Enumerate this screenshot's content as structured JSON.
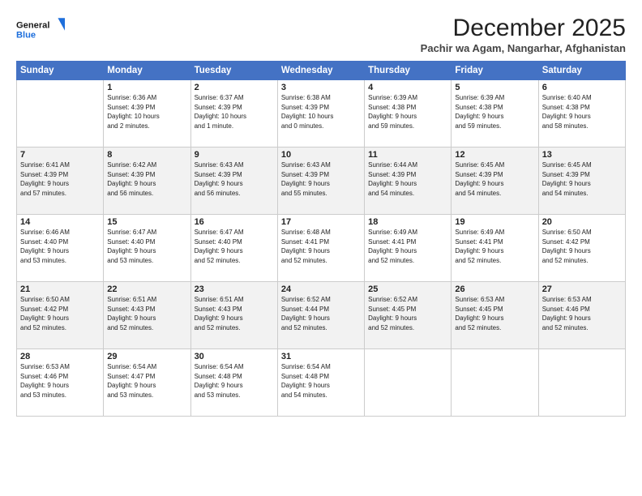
{
  "logo": {
    "line1": "General",
    "line2": "Blue"
  },
  "header": {
    "month": "December 2025",
    "location": "Pachir wa Agam, Nangarhar, Afghanistan"
  },
  "days_of_week": [
    "Sunday",
    "Monday",
    "Tuesday",
    "Wednesday",
    "Thursday",
    "Friday",
    "Saturday"
  ],
  "weeks": [
    [
      {
        "day": "",
        "info": ""
      },
      {
        "day": "1",
        "info": "Sunrise: 6:36 AM\nSunset: 4:39 PM\nDaylight: 10 hours\nand 2 minutes."
      },
      {
        "day": "2",
        "info": "Sunrise: 6:37 AM\nSunset: 4:39 PM\nDaylight: 10 hours\nand 1 minute."
      },
      {
        "day": "3",
        "info": "Sunrise: 6:38 AM\nSunset: 4:39 PM\nDaylight: 10 hours\nand 0 minutes."
      },
      {
        "day": "4",
        "info": "Sunrise: 6:39 AM\nSunset: 4:38 PM\nDaylight: 9 hours\nand 59 minutes."
      },
      {
        "day": "5",
        "info": "Sunrise: 6:39 AM\nSunset: 4:38 PM\nDaylight: 9 hours\nand 59 minutes."
      },
      {
        "day": "6",
        "info": "Sunrise: 6:40 AM\nSunset: 4:38 PM\nDaylight: 9 hours\nand 58 minutes."
      }
    ],
    [
      {
        "day": "7",
        "info": "Sunrise: 6:41 AM\nSunset: 4:39 PM\nDaylight: 9 hours\nand 57 minutes."
      },
      {
        "day": "8",
        "info": "Sunrise: 6:42 AM\nSunset: 4:39 PM\nDaylight: 9 hours\nand 56 minutes."
      },
      {
        "day": "9",
        "info": "Sunrise: 6:43 AM\nSunset: 4:39 PM\nDaylight: 9 hours\nand 56 minutes."
      },
      {
        "day": "10",
        "info": "Sunrise: 6:43 AM\nSunset: 4:39 PM\nDaylight: 9 hours\nand 55 minutes."
      },
      {
        "day": "11",
        "info": "Sunrise: 6:44 AM\nSunset: 4:39 PM\nDaylight: 9 hours\nand 54 minutes."
      },
      {
        "day": "12",
        "info": "Sunrise: 6:45 AM\nSunset: 4:39 PM\nDaylight: 9 hours\nand 54 minutes."
      },
      {
        "day": "13",
        "info": "Sunrise: 6:45 AM\nSunset: 4:39 PM\nDaylight: 9 hours\nand 54 minutes."
      }
    ],
    [
      {
        "day": "14",
        "info": "Sunrise: 6:46 AM\nSunset: 4:40 PM\nDaylight: 9 hours\nand 53 minutes."
      },
      {
        "day": "15",
        "info": "Sunrise: 6:47 AM\nSunset: 4:40 PM\nDaylight: 9 hours\nand 53 minutes."
      },
      {
        "day": "16",
        "info": "Sunrise: 6:47 AM\nSunset: 4:40 PM\nDaylight: 9 hours\nand 52 minutes."
      },
      {
        "day": "17",
        "info": "Sunrise: 6:48 AM\nSunset: 4:41 PM\nDaylight: 9 hours\nand 52 minutes."
      },
      {
        "day": "18",
        "info": "Sunrise: 6:49 AM\nSunset: 4:41 PM\nDaylight: 9 hours\nand 52 minutes."
      },
      {
        "day": "19",
        "info": "Sunrise: 6:49 AM\nSunset: 4:41 PM\nDaylight: 9 hours\nand 52 minutes."
      },
      {
        "day": "20",
        "info": "Sunrise: 6:50 AM\nSunset: 4:42 PM\nDaylight: 9 hours\nand 52 minutes."
      }
    ],
    [
      {
        "day": "21",
        "info": "Sunrise: 6:50 AM\nSunset: 4:42 PM\nDaylight: 9 hours\nand 52 minutes."
      },
      {
        "day": "22",
        "info": "Sunrise: 6:51 AM\nSunset: 4:43 PM\nDaylight: 9 hours\nand 52 minutes."
      },
      {
        "day": "23",
        "info": "Sunrise: 6:51 AM\nSunset: 4:43 PM\nDaylight: 9 hours\nand 52 minutes."
      },
      {
        "day": "24",
        "info": "Sunrise: 6:52 AM\nSunset: 4:44 PM\nDaylight: 9 hours\nand 52 minutes."
      },
      {
        "day": "25",
        "info": "Sunrise: 6:52 AM\nSunset: 4:45 PM\nDaylight: 9 hours\nand 52 minutes."
      },
      {
        "day": "26",
        "info": "Sunrise: 6:53 AM\nSunset: 4:45 PM\nDaylight: 9 hours\nand 52 minutes."
      },
      {
        "day": "27",
        "info": "Sunrise: 6:53 AM\nSunset: 4:46 PM\nDaylight: 9 hours\nand 52 minutes."
      }
    ],
    [
      {
        "day": "28",
        "info": "Sunrise: 6:53 AM\nSunset: 4:46 PM\nDaylight: 9 hours\nand 53 minutes."
      },
      {
        "day": "29",
        "info": "Sunrise: 6:54 AM\nSunset: 4:47 PM\nDaylight: 9 hours\nand 53 minutes."
      },
      {
        "day": "30",
        "info": "Sunrise: 6:54 AM\nSunset: 4:48 PM\nDaylight: 9 hours\nand 53 minutes."
      },
      {
        "day": "31",
        "info": "Sunrise: 6:54 AM\nSunset: 4:48 PM\nDaylight: 9 hours\nand 54 minutes."
      },
      {
        "day": "",
        "info": ""
      },
      {
        "day": "",
        "info": ""
      },
      {
        "day": "",
        "info": ""
      }
    ]
  ]
}
